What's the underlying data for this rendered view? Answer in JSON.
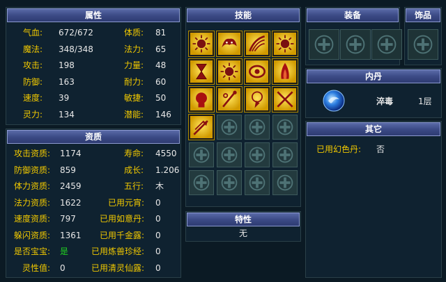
{
  "attr": {
    "title": "属性",
    "left": [
      {
        "label": "气血:",
        "value": "672/672"
      },
      {
        "label": "魔法:",
        "value": "348/348"
      },
      {
        "label": "攻击:",
        "value": "198"
      },
      {
        "label": "防御:",
        "value": "163"
      },
      {
        "label": "速度:",
        "value": "39"
      },
      {
        "label": "灵力:",
        "value": "134"
      }
    ],
    "right": [
      {
        "label": "体质:",
        "value": "81"
      },
      {
        "label": "法力:",
        "value": "65"
      },
      {
        "label": "力量:",
        "value": "48"
      },
      {
        "label": "耐力:",
        "value": "60"
      },
      {
        "label": "敏捷:",
        "value": "50"
      },
      {
        "label": "潜能:",
        "value": "146"
      }
    ]
  },
  "quality": {
    "title": "资质",
    "left": [
      {
        "label": "攻击资质:",
        "value": "1174"
      },
      {
        "label": "防御资质:",
        "value": "859"
      },
      {
        "label": "体力资质:",
        "value": "2459"
      },
      {
        "label": "法力资质:",
        "value": "1622"
      },
      {
        "label": "速度资质:",
        "value": "797"
      },
      {
        "label": "躲闪资质:",
        "value": "1361"
      },
      {
        "label": "是否宝宝:",
        "value": "是"
      },
      {
        "label": "灵性值:",
        "value": "0"
      }
    ],
    "right": [
      {
        "label": "寿命:",
        "value": "4550"
      },
      {
        "label": "成长:",
        "value": "1.206"
      },
      {
        "label": "五行:",
        "value": "木"
      },
      {
        "label": "已用元宵:",
        "value": "0"
      },
      {
        "label": "已用如意丹:",
        "value": "0"
      },
      {
        "label": "已用千金露:",
        "value": "0"
      },
      {
        "label": "已用炼兽珍经:",
        "value": "0"
      },
      {
        "label": "已用清灵仙露:",
        "value": "0"
      }
    ]
  },
  "skills": {
    "title": "技能",
    "icons": [
      "sun-skill-icon",
      "beast-skill-icon",
      "claw-skill-icon",
      "sun-skill-icon",
      "hourglass-skill-icon",
      "sun-skill-icon",
      "shield-skill-icon",
      "flame-skill-icon",
      "head-skill-icon",
      "staff-skill-icon",
      "lightning-skill-icon",
      "crossed-swords-skill-icon",
      "arrow-skill-icon"
    ],
    "total_slots": 24
  },
  "trait": {
    "title": "特性",
    "value": "无"
  },
  "equip": {
    "title": "装备",
    "slots": 3
  },
  "ornament": {
    "title": "饰品"
  },
  "inner": {
    "title": "内丹",
    "name": "淬毒",
    "level": "1层",
    "icon": "blue-core-icon"
  },
  "other": {
    "title": "其它",
    "label": "已用幻色丹:",
    "value": "否"
  }
}
